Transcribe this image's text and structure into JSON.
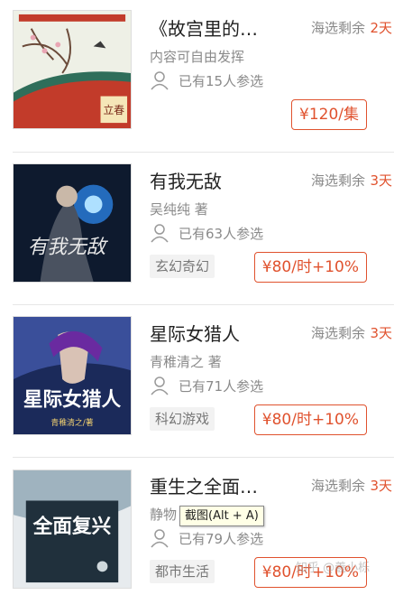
{
  "remain_label": "海选剩余",
  "tooltip": "截图(Alt + A)",
  "watermark": "知乎 @羲小栎",
  "colors": {
    "accent": "#e0522e",
    "muted": "#8a8a8a",
    "tag_bg": "#f2f2f2"
  },
  "items": [
    {
      "title": "《故宫里的…",
      "subtitle": "内容可自由发挥",
      "participants": "已有15人参选",
      "days": "2天",
      "tag": "",
      "price": "¥120/集",
      "cover_icon": "palace-roof-cover-icon"
    },
    {
      "title": "有我无敌",
      "subtitle": "吴纯纯  著",
      "participants": "已有63人参选",
      "days": "3天",
      "tag": "玄幻奇幻",
      "price": "¥80/时+10%",
      "cover_icon": "fantasy-warrior-cover-icon"
    },
    {
      "title": "星际女猎人",
      "subtitle": "青稚清之  著",
      "participants": "已有71人参选",
      "days": "3天",
      "tag": "科幻游戏",
      "price": "¥80/时+10%",
      "cover_icon": "scifi-huntress-cover-icon"
    },
    {
      "title": "重生之全面…",
      "subtitle": "静物",
      "participants": "已有79人参选",
      "days": "3天",
      "tag": "都市生活",
      "price": "¥80/时+10%",
      "cover_icon": "city-revival-cover-icon"
    }
  ],
  "cover_texts": {
    "cover1_small": "立春",
    "cover2_title": "有我无敌",
    "cover3_title": "星际女猎人",
    "cover3_author": "青稚清之/著",
    "cover4_title": "全面复兴"
  }
}
